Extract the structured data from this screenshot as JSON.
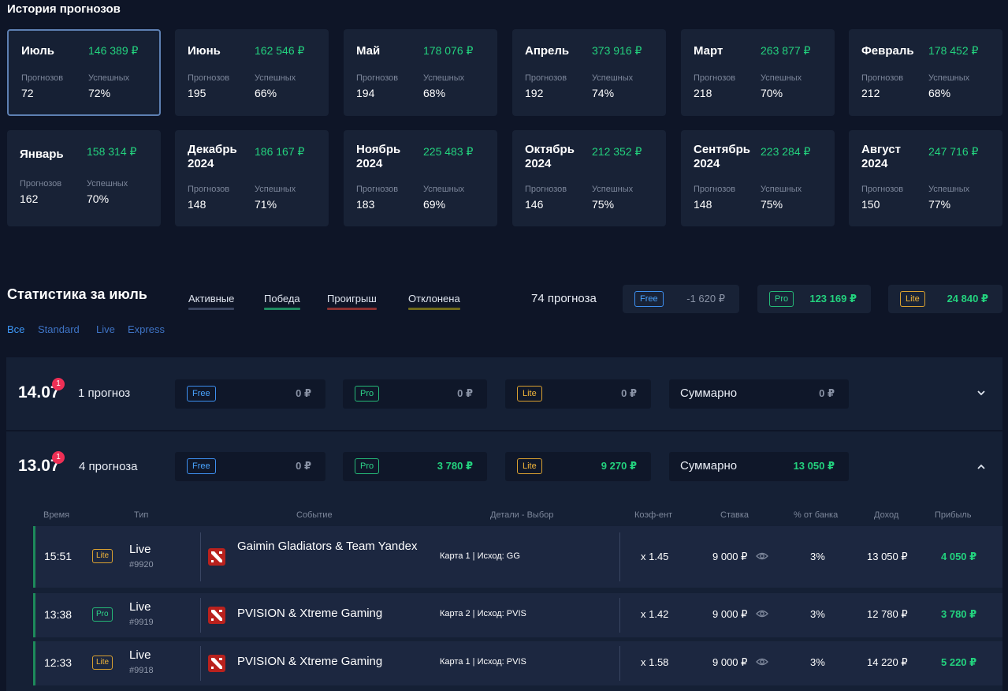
{
  "history": {
    "title": "История прогнозов",
    "label_forecasts": "Прогнозов",
    "label_success": "Успешных",
    "cards": [
      {
        "name": "Июль",
        "amount": "146 389 ₽",
        "forecasts": "72",
        "success": "72%",
        "active": true
      },
      {
        "name": "Июнь",
        "amount": "162 546 ₽",
        "forecasts": "195",
        "success": "66%"
      },
      {
        "name": "Май",
        "amount": "178 076 ₽",
        "forecasts": "194",
        "success": "68%"
      },
      {
        "name": "Апрель",
        "amount": "373 916 ₽",
        "forecasts": "192",
        "success": "74%"
      },
      {
        "name": "Март",
        "amount": "263 877 ₽",
        "forecasts": "218",
        "success": "70%"
      },
      {
        "name": "Февраль",
        "amount": "178 452 ₽",
        "forecasts": "212",
        "success": "68%"
      },
      {
        "name": "Январь",
        "amount": "158 314 ₽",
        "forecasts": "162",
        "success": "70%"
      },
      {
        "name": "Декабрь 2024",
        "amount": "186 167 ₽",
        "forecasts": "148",
        "success": "71%"
      },
      {
        "name": "Ноябрь 2024",
        "amount": "225 483 ₽",
        "forecasts": "183",
        "success": "69%"
      },
      {
        "name": "Октябрь 2024",
        "amount": "212 352 ₽",
        "forecasts": "146",
        "success": "75%"
      },
      {
        "name": "Сентябрь 2024",
        "amount": "223 284 ₽",
        "forecasts": "148",
        "success": "75%"
      },
      {
        "name": "Август 2024",
        "amount": "247 716 ₽",
        "forecasts": "150",
        "success": "77%"
      }
    ]
  },
  "stats": {
    "title": "Статистика за июль",
    "filters": [
      {
        "label": "Активные",
        "color": "#3a4560"
      },
      {
        "label": "Победа",
        "color": "#1f8a61"
      },
      {
        "label": "Проигрыш",
        "color": "#8b3131"
      },
      {
        "label": "Отклонена",
        "color": "#6f6a1c"
      }
    ],
    "total_count": "74 прогноза",
    "summary": [
      {
        "tag": "Free",
        "value": "-1 620 ₽"
      },
      {
        "tag": "Pro",
        "value": "123 169 ₽"
      },
      {
        "tag": "Lite",
        "value": "24 840 ₽"
      }
    ],
    "sub_tabs": [
      "Все",
      "Standard",
      "Live",
      "Express"
    ]
  },
  "days": [
    {
      "date": "14.07",
      "badge": "1",
      "count": "1 прогноз",
      "free": "0 ₽",
      "pro": "0 ₽",
      "lite": "0 ₽",
      "sum_label": "Суммарно",
      "sum": "0 ₽"
    },
    {
      "date": "13.07",
      "badge": "1",
      "count": "4 прогноза",
      "free": "0 ₽",
      "pro": "3 780 ₽",
      "lite": "9 270 ₽",
      "sum_label": "Суммарно",
      "sum": "13 050 ₽"
    }
  ],
  "table": {
    "headers": [
      "Время",
      "Тип",
      "Событие",
      "Детали - Выбор",
      "Коэф-ент",
      "Ставка",
      "% от банка",
      "Доход",
      "Прибыль"
    ],
    "rows": [
      {
        "time": "15:51",
        "tag": "Lite",
        "type": "Live",
        "id": "#9920",
        "event": "Gaimin Gladiators & Team Yandex",
        "details": "Карта 1 | Исход: GG",
        "koef": "x 1.45",
        "stake": "9 000 ₽",
        "pct": "3%",
        "income": "13 050 ₽",
        "profit": "4 050 ₽"
      },
      {
        "time": "13:38",
        "tag": "Pro",
        "type": "Live",
        "id": "#9919",
        "event": "PVISION & Xtreme Gaming",
        "details": "Карта 2 | Исход: PVIS",
        "koef": "x 1.42",
        "stake": "9 000 ₽",
        "pct": "3%",
        "income": "12 780 ₽",
        "profit": "3 780 ₽"
      },
      {
        "time": "12:33",
        "tag": "Lite",
        "type": "Live",
        "id": "#9918",
        "event": "PVISION & Xtreme Gaming",
        "details": "Карта 1 | Исход: PVIS",
        "koef": "x 1.58",
        "stake": "9 000 ₽",
        "pct": "3%",
        "income": "14 220 ₽",
        "profit": "5 220 ₽"
      }
    ]
  },
  "colors": {
    "bg": "#0e1527",
    "card": "#182236",
    "green": "#23d27e",
    "free": "#3d8ff0",
    "pro": "#25b877",
    "lite": "#d9a030",
    "dot": "#ee2f55"
  }
}
